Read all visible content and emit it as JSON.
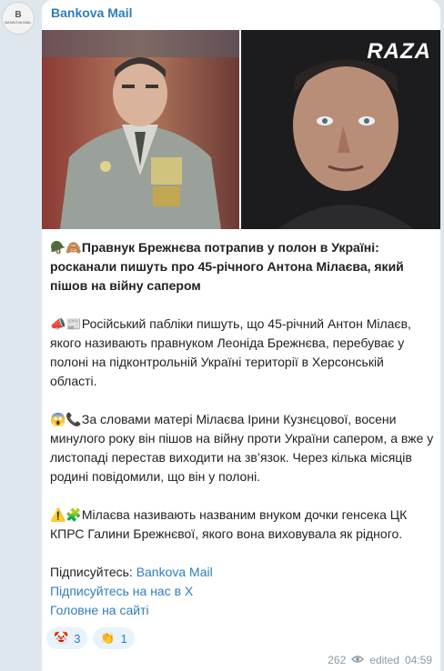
{
  "avatar": {
    "big": "B",
    "small": "BANKOVA MAIL"
  },
  "channel_name": "Bankova Mail",
  "photo_watermark": "RAZA",
  "headline": {
    "emoji": "🪖🙈",
    "text": "Правнук Брежнєва потрапив у полон в Україні: росканали пишуть про 45-річного Антона Мілаєва, який пішов на війну сапером"
  },
  "paragraphs": [
    {
      "emoji": "📣📰",
      "text": "Російський пабліки пишуть, що 45-річний Антон Мілаєв, якого називають правнуком Леоніда Брежнєва, перебуває у полоні на підконтрольній Україні території в Херсонській області."
    },
    {
      "emoji": "😱📞",
      "text": "За словами матері Мілаєва Ірини Кузнєцової, восени минулого року він пішов на війну проти України сапером, а вже у листопаді перестав виходити на зв’язок. Через кілька місяців родині повідомили, що він у полоні."
    },
    {
      "emoji": "⚠️🧩",
      "text": "Мілаєва називають названим внуком дочки генсека ЦК КПРС Галини Брежнєвої, якого вона виховувала як рідного."
    }
  ],
  "footer": {
    "subscribe_label": "Підписуйтесь: ",
    "subscribe_link": "Bankova Mail",
    "x_link": "Підписуйтесь на нас в X",
    "site_link": "Головне на сайті"
  },
  "reactions": [
    {
      "emoji": "🤡",
      "count": "3"
    },
    {
      "emoji": "👏",
      "count": "1"
    }
  ],
  "meta": {
    "views": "262",
    "edited": "edited",
    "time": "04:59"
  },
  "colors": {
    "accent": "#2f7dbf",
    "bubble": "#ffffff",
    "background": "#dfe7ee"
  }
}
